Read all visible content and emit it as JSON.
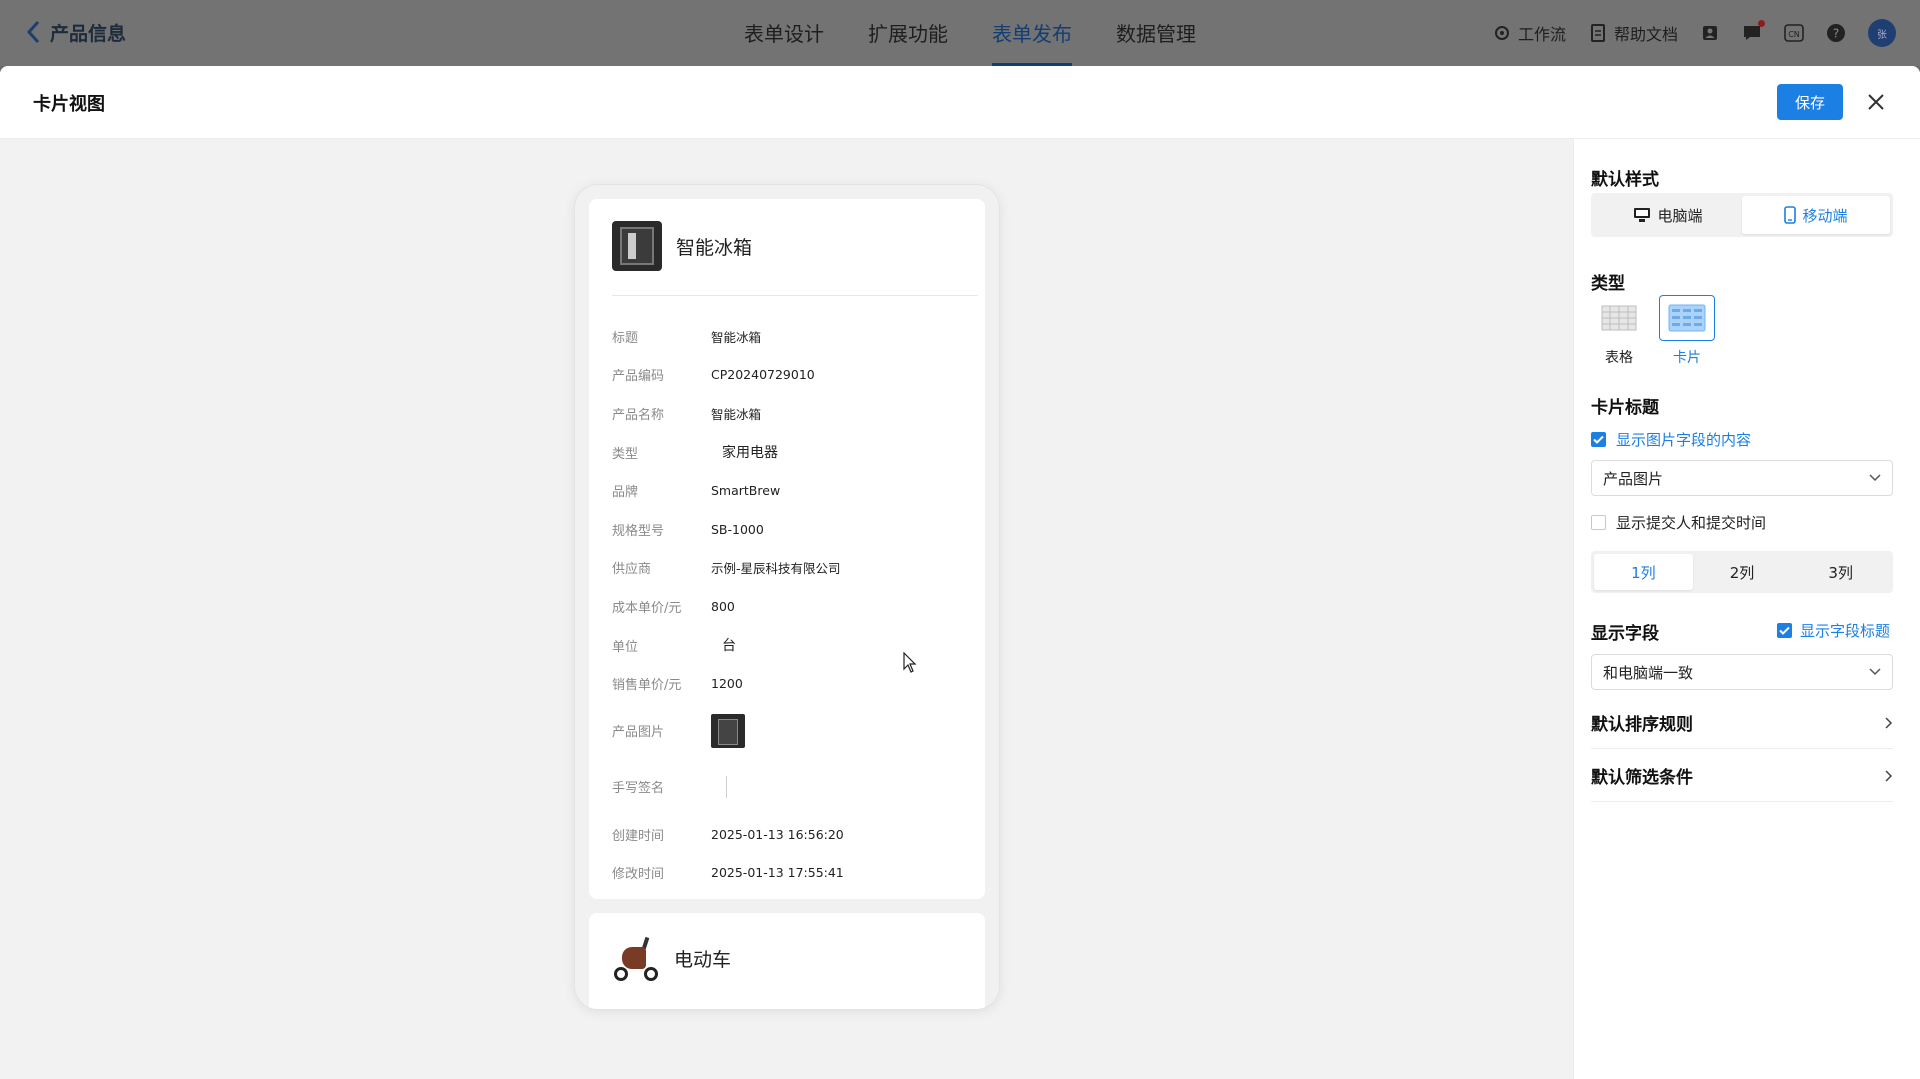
{
  "topbar": {
    "back_label": "产品信息",
    "tabs": [
      {
        "label": "表单设计",
        "active": false
      },
      {
        "label": "扩展功能",
        "active": false
      },
      {
        "label": "表单发布",
        "active": true
      },
      {
        "label": "数据管理",
        "active": false
      }
    ],
    "workflow_label": "工作流",
    "help_doc_label": "帮助文档",
    "lang_label": "CN",
    "avatar_text": "张"
  },
  "modal": {
    "title": "卡片视图",
    "save_label": "保存"
  },
  "preview": {
    "card1": {
      "title": "智能冰箱",
      "fields": [
        {
          "label": "标题",
          "value": "智能冰箱"
        },
        {
          "label": "产品编码",
          "value": "CP20240729010"
        },
        {
          "label": "产品名称",
          "value": "智能冰箱"
        },
        {
          "label": "类型",
          "value": "家用电器"
        },
        {
          "label": "品牌",
          "value": "SmartBrew"
        },
        {
          "label": "规格型号",
          "value": "SB-1000"
        },
        {
          "label": "供应商",
          "value": "示例-星辰科技有限公司"
        },
        {
          "label": "成本单价/元",
          "value": "800"
        },
        {
          "label": "单位",
          "value": "台"
        },
        {
          "label": "销售单价/元",
          "value": "1200"
        },
        {
          "label": "产品图片",
          "value": ""
        },
        {
          "label": "手写签名",
          "value": ""
        },
        {
          "label": "创建时间",
          "value": "2025-01-13 16:56:20"
        },
        {
          "label": "修改时间",
          "value": "2025-01-13 17:55:41"
        }
      ]
    },
    "card2": {
      "title": "电动车"
    }
  },
  "panel": {
    "default_style_title": "默认样式",
    "device_options": [
      {
        "label": "电脑端",
        "active": false
      },
      {
        "label": "移动端",
        "active": true
      }
    ],
    "type_title": "类型",
    "type_options": [
      {
        "label": "表格",
        "active": false
      },
      {
        "label": "卡片",
        "active": true
      }
    ],
    "card_title_section": "卡片标题",
    "show_image_field": {
      "label": "显示图片字段的内容",
      "checked": true
    },
    "image_field_select": "产品图片",
    "show_submitter": {
      "label": "显示提交人和提交时间",
      "checked": false
    },
    "columns": [
      {
        "label": "1列",
        "active": true
      },
      {
        "label": "2列",
        "active": false
      },
      {
        "label": "3列",
        "active": false
      }
    ],
    "display_fields_title": "显示字段",
    "show_field_title": {
      "label": "显示字段标题",
      "checked": true
    },
    "display_fields_select": "和电脑端一致",
    "sort_rule_label": "默认排序规则",
    "filter_label": "默认筛选条件"
  },
  "colors": {
    "accent": "#1c7fe3",
    "overlay": "#737374"
  }
}
